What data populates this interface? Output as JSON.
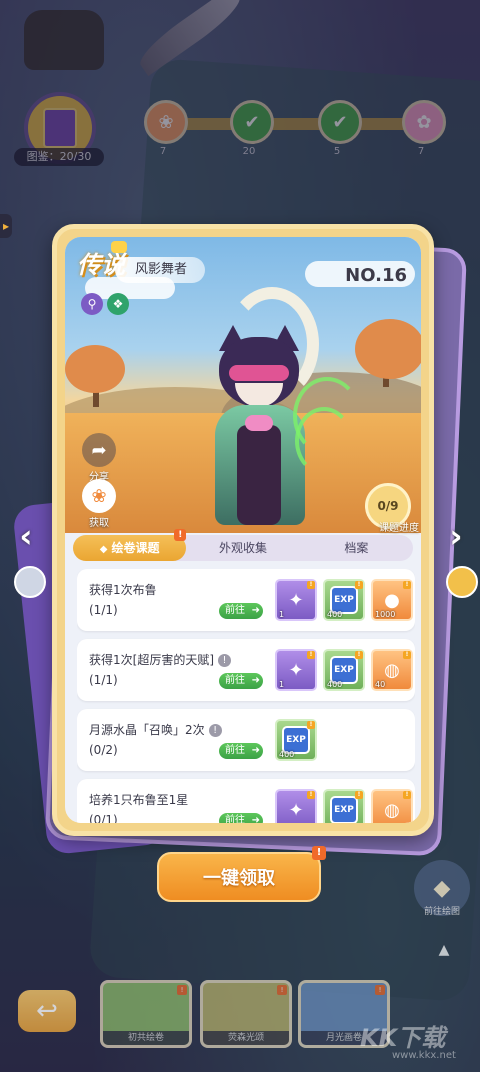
{
  "top": {
    "book_count": "图鉴：20/30",
    "milestones": [
      {
        "label": "7",
        "icon": "paw-icon",
        "color": "#f2a16a",
        "done": false
      },
      {
        "label": "20",
        "icon": "check-icon",
        "color": "#4cb050",
        "done": true
      },
      {
        "label": "5",
        "icon": "check-icon",
        "color": "#4cb050",
        "done": true
      },
      {
        "label": "7",
        "icon": "gift-icon",
        "color": "#f0a0c8",
        "done": false
      }
    ]
  },
  "card": {
    "rarity": "传说",
    "name": "风影舞者",
    "number": "NO.16",
    "attributes": [
      {
        "icon": "key-icon",
        "symbol": "⚲",
        "color": "#7c5bc4"
      },
      {
        "icon": "leaf-icon",
        "symbol": "❖",
        "color": "#2fa36b"
      }
    ],
    "share_label": "分享",
    "obtain_label": "获取",
    "progress_value": "0/9",
    "progress_label": "课题进度"
  },
  "tabs": [
    {
      "label": "绘卷课题",
      "active": true,
      "badge": "!"
    },
    {
      "label": "外观收集",
      "active": false
    },
    {
      "label": "档案",
      "active": false
    }
  ],
  "tasks": [
    {
      "title": "获得1次布鲁",
      "info": false,
      "progress": "(1/1)",
      "go_label": "前往",
      "rewards": [
        {
          "type": "crystal-icon",
          "style": "r-purple",
          "amount": "1"
        },
        {
          "type": "exp-icon",
          "style": "r-green",
          "amount": "400"
        },
        {
          "type": "berry-icon",
          "style": "r-orange",
          "amount": "1000"
        }
      ]
    },
    {
      "title": "获得1次[超厉害的天赋]",
      "info": true,
      "progress": "(1/1)",
      "go_label": "前往",
      "rewards": [
        {
          "type": "crystal-icon",
          "style": "r-purple",
          "amount": "1"
        },
        {
          "type": "exp-icon",
          "style": "r-green",
          "amount": "400"
        },
        {
          "type": "potion-icon",
          "style": "r-orange",
          "amount": "40"
        }
      ]
    },
    {
      "title": "月源水晶「召唤」2次",
      "info": true,
      "progress": "(0/2)",
      "go_label": "前往",
      "rewards": [
        {
          "type": "exp-icon",
          "style": "r-green",
          "amount": "400"
        }
      ]
    },
    {
      "title": "培养1只布鲁至1星",
      "info": false,
      "progress": "(0/1)",
      "go_label": "前往",
      "rewards": [
        {
          "type": "crystal-icon",
          "style": "r-purple",
          "amount": ""
        },
        {
          "type": "exp-icon",
          "style": "r-green",
          "amount": ""
        },
        {
          "type": "potion-icon",
          "style": "r-orange",
          "amount": ""
        }
      ]
    }
  ],
  "claim": {
    "label": "一键领取",
    "badge": "!"
  },
  "bottom": {
    "thumbs": [
      {
        "caption": "初共绘卷",
        "color": "#8fbf6a"
      },
      {
        "caption": "荧森光颂",
        "color": "#b9b36a"
      },
      {
        "caption": "月光画卷",
        "color": "#6a8fbf"
      }
    ],
    "emblem_label": "前往绘图"
  },
  "watermark": "KK下载",
  "watermark_url": "www.kkx.net"
}
